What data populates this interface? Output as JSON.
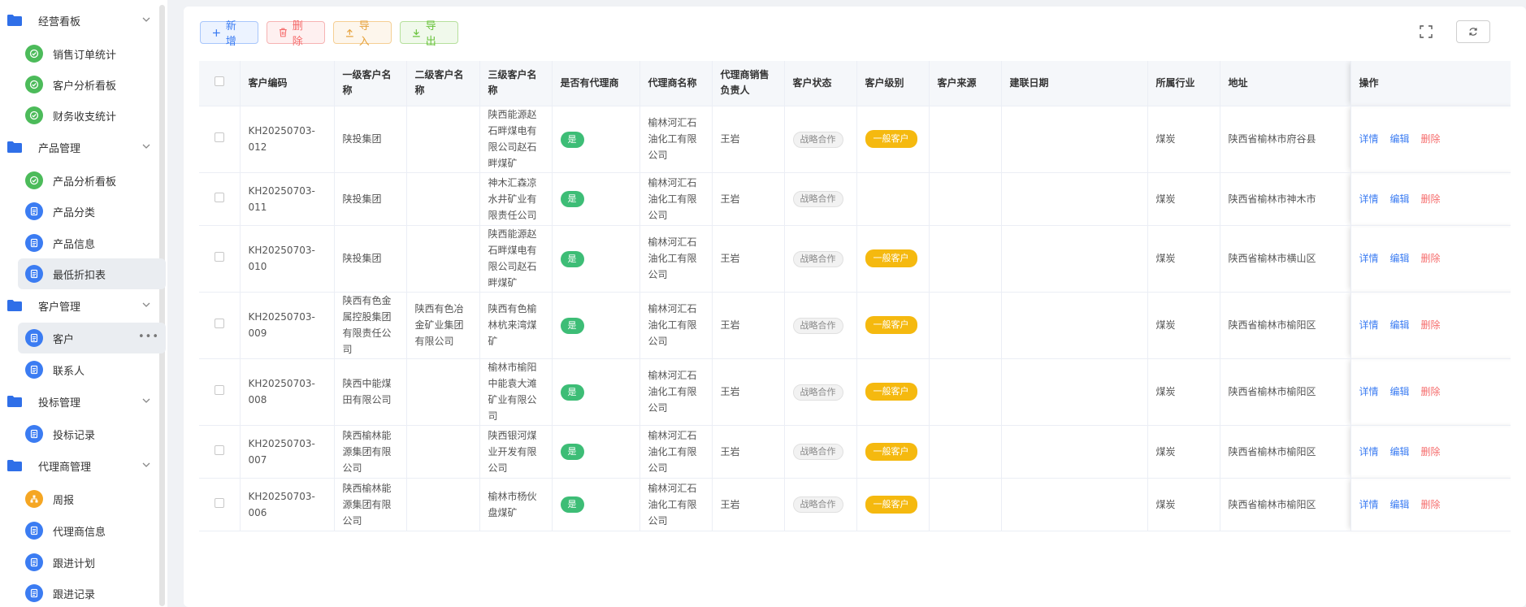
{
  "sidebar": {
    "groups": [
      {
        "label": "经营看板",
        "items": [
          {
            "label": "销售订单统计",
            "icon": "chart-icon",
            "color": "green"
          },
          {
            "label": "客户分析看板",
            "icon": "chart-icon",
            "color": "green"
          },
          {
            "label": "财务收支统计",
            "icon": "chart-icon",
            "color": "green"
          }
        ]
      },
      {
        "label": "产品管理",
        "items": [
          {
            "label": "产品分析看板",
            "icon": "chart-icon",
            "color": "green"
          },
          {
            "label": "产品分类",
            "icon": "document-icon",
            "color": "blue"
          },
          {
            "label": "产品信息",
            "icon": "document-icon",
            "color": "blue"
          },
          {
            "label": "最低折扣表",
            "icon": "document-icon",
            "color": "blue"
          }
        ]
      },
      {
        "label": "客户管理",
        "items": [
          {
            "label": "客户",
            "icon": "document-icon",
            "color": "blue"
          },
          {
            "label": "联系人",
            "icon": "document-icon",
            "color": "blue"
          }
        ]
      },
      {
        "label": "投标管理",
        "items": [
          {
            "label": "投标记录",
            "icon": "document-icon",
            "color": "blue"
          }
        ]
      },
      {
        "label": "代理商管理",
        "items": [
          {
            "label": "周报",
            "icon": "org-icon",
            "color": "orange"
          },
          {
            "label": "代理商信息",
            "icon": "document-icon",
            "color": "blue"
          },
          {
            "label": "跟进计划",
            "icon": "document-icon",
            "color": "blue"
          },
          {
            "label": "跟进记录",
            "icon": "document-icon",
            "color": "blue"
          }
        ]
      }
    ]
  },
  "toolbar": {
    "add_label": "新增",
    "delete_label": "删除",
    "import_label": "导入",
    "export_label": "导出"
  },
  "table": {
    "headers": {
      "code": "客户编码",
      "level1": "一级客户名称",
      "level2": "二级客户名称",
      "level3": "三级客户名称",
      "has_agent": "是否有代理商",
      "agent_name": "代理商名称",
      "agent_sales": "代理商销售负责人",
      "status": "客户状态",
      "level": "客户级别",
      "source": "客户来源",
      "date": "建联日期",
      "industry": "所属行业",
      "address": "地址",
      "ops": "操作"
    },
    "ops": {
      "detail": "详情",
      "edit": "编辑",
      "delete": "删除"
    },
    "rows": [
      {
        "code": "KH20250703-012",
        "level1": "陕投集团",
        "level2": "",
        "level3": "陕西能源赵石畔煤电有限公司赵石畔煤矿",
        "has_agent": "是",
        "agent_name": "榆林河汇石油化工有限公司",
        "agent_sales": "王岩",
        "status": "战略合作",
        "level": "一般客户",
        "source": "",
        "date": "",
        "industry": "煤炭",
        "address": "陕西省榆林市府谷县"
      },
      {
        "code": "KH20250703-011",
        "level1": "陕投集团",
        "level2": "",
        "level3": "神木汇森凉水井矿业有限责任公司",
        "has_agent": "是",
        "agent_name": "榆林河汇石油化工有限公司",
        "agent_sales": "王岩",
        "status": "战略合作",
        "level": "",
        "source": "",
        "date": "",
        "industry": "煤炭",
        "address": "陕西省榆林市神木市"
      },
      {
        "code": "KH20250703-010",
        "level1": "陕投集团",
        "level2": "",
        "level3": "陕西能源赵石畔煤电有限公司赵石畔煤矿",
        "has_agent": "是",
        "agent_name": "榆林河汇石油化工有限公司",
        "agent_sales": "王岩",
        "status": "战略合作",
        "level": "一般客户",
        "source": "",
        "date": "",
        "industry": "煤炭",
        "address": "陕西省榆林市横山区"
      },
      {
        "code": "KH20250703-009",
        "level1": "陕西有色金属控股集团有限责任公司",
        "level2": "陕西有色冶金矿业集团有限公司",
        "level3": "陕西有色榆林杭来湾煤矿",
        "has_agent": "是",
        "agent_name": "榆林河汇石油化工有限公司",
        "agent_sales": "王岩",
        "status": "战略合作",
        "level": "一般客户",
        "source": "",
        "date": "",
        "industry": "煤炭",
        "address": "陕西省榆林市榆阳区"
      },
      {
        "code": "KH20250703-008",
        "level1": "陕西中能煤田有限公司",
        "level2": "",
        "level3": "榆林市榆阳中能袁大滩矿业有限公司",
        "has_agent": "是",
        "agent_name": "榆林河汇石油化工有限公司",
        "agent_sales": "王岩",
        "status": "战略合作",
        "level": "一般客户",
        "source": "",
        "date": "",
        "industry": "煤炭",
        "address": "陕西省榆林市榆阳区"
      },
      {
        "code": "KH20250703-007",
        "level1": "陕西榆林能源集团有限公司",
        "level2": "",
        "level3": "陕西银河煤业开发有限公司",
        "has_agent": "是",
        "agent_name": "榆林河汇石油化工有限公司",
        "agent_sales": "王岩",
        "status": "战略合作",
        "level": "一般客户",
        "source": "",
        "date": "",
        "industry": "煤炭",
        "address": "陕西省榆林市榆阳区"
      },
      {
        "code": "KH20250703-006",
        "level1": "陕西榆林能源集团有限公司",
        "level2": "",
        "level3": "榆林市杨伙盘煤矿",
        "has_agent": "是",
        "agent_name": "榆林河汇石油化工有限公司",
        "agent_sales": "王岩",
        "status": "战略合作",
        "level": "一般客户",
        "source": "",
        "date": "",
        "industry": "煤炭",
        "address": "陕西省榆林市榆阳区"
      }
    ]
  },
  "colors": {
    "primary": "#3b7cf2",
    "success": "#3dbd76",
    "warning": "#f5b90f",
    "danger": "#f56c6c"
  }
}
